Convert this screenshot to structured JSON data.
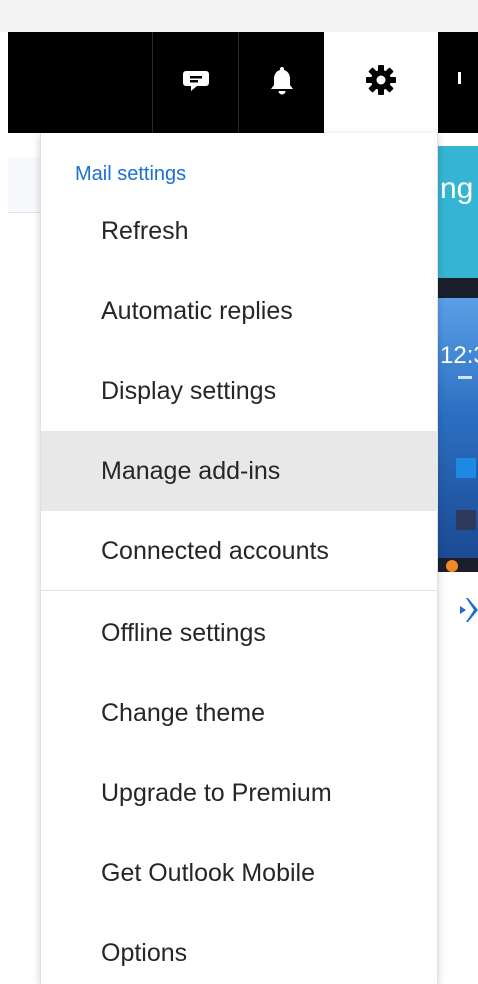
{
  "header": {
    "icons": [
      "chat-icon",
      "bell-icon",
      "gear-icon"
    ]
  },
  "background": {
    "promo_text_fragment": "ng",
    "phone_time_fragment": "12:3"
  },
  "menu": {
    "heading": "Mail settings",
    "group1": [
      {
        "label": "Refresh"
      },
      {
        "label": "Automatic replies"
      },
      {
        "label": "Display settings"
      },
      {
        "label": "Manage add-ins"
      },
      {
        "label": "Connected accounts"
      }
    ],
    "group2": [
      {
        "label": "Offline settings"
      },
      {
        "label": "Change theme"
      },
      {
        "label": "Upgrade to Premium"
      },
      {
        "label": "Get Outlook Mobile"
      },
      {
        "label": "Options"
      }
    ],
    "hovered_item": "Manage add-ins"
  },
  "colors": {
    "header_bg": "#000000",
    "menu_heading": "#1c6fd1",
    "hover_bg": "#e8e8e8",
    "promo_bg": "#36b4d4"
  }
}
